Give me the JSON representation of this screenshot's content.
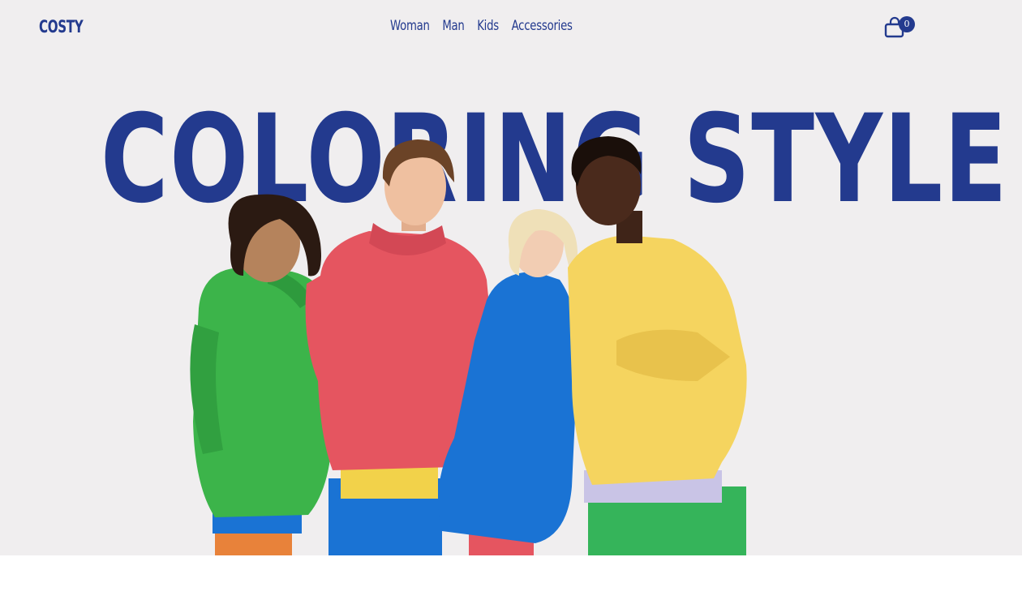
{
  "header": {
    "logo": "COSTY",
    "nav": [
      {
        "label": "Woman"
      },
      {
        "label": "Man"
      },
      {
        "label": "Kids"
      },
      {
        "label": "Accessories"
      }
    ],
    "cart": {
      "icon": "shopping-bag-icon",
      "count": "0"
    }
  },
  "hero": {
    "headline": "COLORING STYLE",
    "image": "four-models-in-colorful-hoodies",
    "colors": {
      "brand": "#233a8e",
      "background": "#f0eeef",
      "green": "#3cb44a",
      "red": "#e55560",
      "blue": "#1a73d4",
      "yellow": "#f5d45f"
    }
  }
}
